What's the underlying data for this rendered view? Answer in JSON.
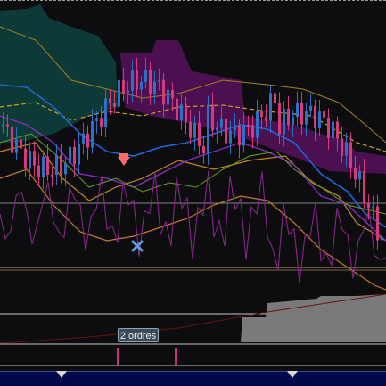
{
  "order_marker": {
    "label": "2 ordres"
  },
  "colors": {
    "background": "#0d0d10",
    "candle_up": "#2a72c4",
    "candle_down": "#d8387e",
    "ichimoku_green": "#0e4a44",
    "ichimoku_purple": "#5a1260",
    "bollinger": "#c8861c",
    "moving_avg": "#1e66d8",
    "volume_area": "#7a7a7a",
    "nav_strip": "#000a4a",
    "buy_arrow": "#ff6a6a",
    "cross_marker": "#5aa0e6"
  },
  "icons": [
    "down-arrow-signal-icon",
    "cross-signal-icon",
    "nav-marker-icon"
  ]
}
